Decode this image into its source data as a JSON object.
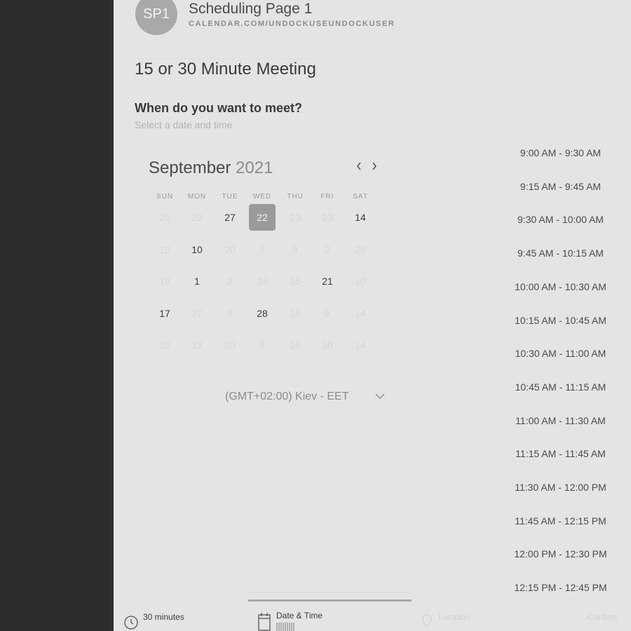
{
  "header": {
    "avatar_initials": "SP1",
    "title": "Scheduling Page 1",
    "url": "CALENDAR.COM/UNDOCKUSEUNDOCKUSER"
  },
  "meeting": {
    "title": "15 or 30 Minute Meeting",
    "question": "When do you want to meet?",
    "subtitle": "Select a date and time"
  },
  "calendar": {
    "month": "September",
    "year": "2021",
    "weekdays": [
      "SUN",
      "MON",
      "TUE",
      "WED",
      "THU",
      "FRI",
      "SAT"
    ],
    "weeks": [
      [
        "26",
        "29",
        "27",
        "22",
        "23",
        "23",
        "14"
      ],
      [
        "13",
        "10",
        "20",
        "7",
        "8",
        "2",
        "29"
      ],
      [
        "14",
        "1",
        "2",
        "24",
        "15",
        "21",
        "10"
      ],
      [
        "17",
        "27",
        "8",
        "28",
        "15",
        "9",
        "14"
      ],
      [
        "20",
        "13",
        "20",
        "3",
        "16",
        "20",
        "14"
      ]
    ],
    "active_days": [
      [
        0,
        2
      ],
      [
        0,
        3
      ],
      [
        0,
        6
      ],
      [
        1,
        1
      ],
      [
        2,
        1
      ],
      [
        2,
        5
      ],
      [
        3,
        0
      ],
      [
        3,
        3
      ]
    ],
    "selected_day": "22"
  },
  "timezone": {
    "label": "(GMT+02:00) Kiev - EET"
  },
  "time_slots": [
    "9:00 AM - 9:30 AM",
    "9:15 AM - 9:45 AM",
    "9:30 AM - 10:00 AM",
    "9:45 AM - 10:15 AM",
    "10:00 AM - 10:30 AM",
    "10:15 AM - 10:45 AM",
    "10:30 AM - 11:00 AM",
    "10:45 AM - 11:15 AM",
    "11:00 AM - 11:30 AM",
    "11:15 AM - 11:45 AM",
    "11:30 AM - 12:00 PM",
    "11:45 AM - 12:15 PM",
    "12:00 PM - 12:30 PM",
    "12:15 PM - 12:45 PM"
  ],
  "footer": {
    "duration_label": "30 minutes",
    "datetime_label": "Date & Time",
    "location_label": "Location",
    "confirm_label": "Confirm"
  },
  "icons": {
    "duration": "clock-icon",
    "datetime": "calendar-icon",
    "location": "location-pin-icon",
    "prev": "chevron-left-icon",
    "next": "chevron-right-icon",
    "timezone": "chevron-down-icon"
  }
}
